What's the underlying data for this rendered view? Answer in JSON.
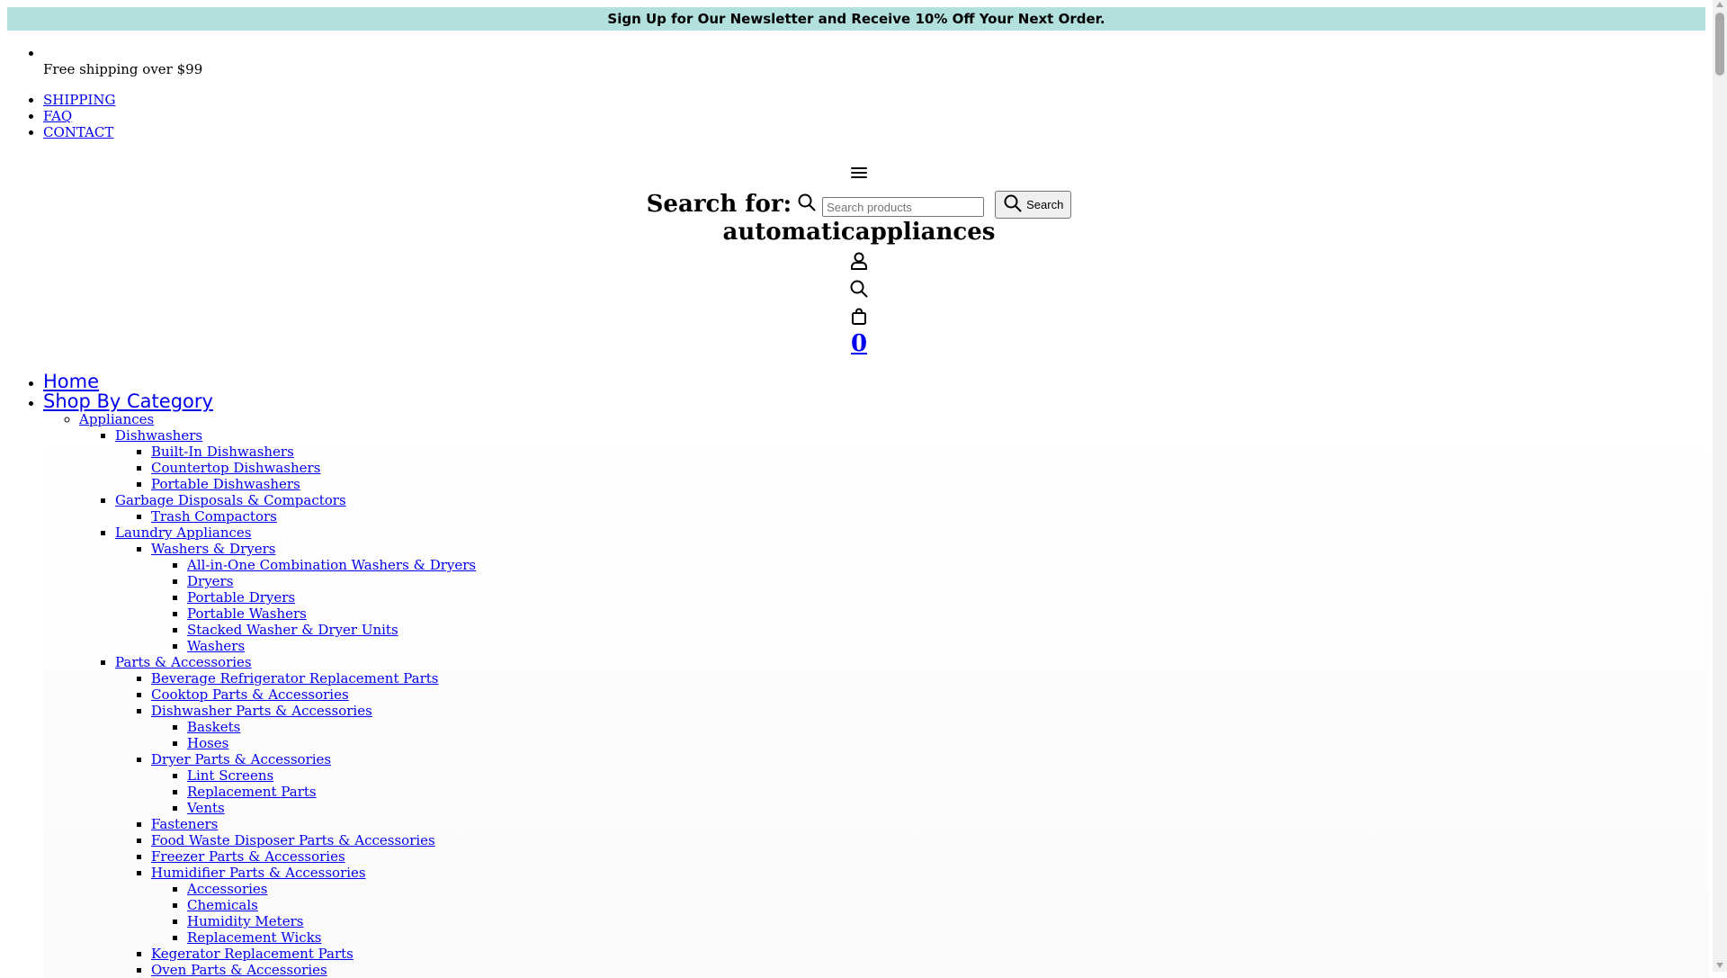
{
  "announcement": "Sign Up for Our Newsletter and Receive 10% Off Your Next Order.",
  "shipping_note": "Free shipping over $99",
  "utility_links": [
    "SHIPPING",
    "FAQ",
    "CONTACT"
  ],
  "search": {
    "label": "Search for:",
    "placeholder": "Search products",
    "button_label": "Search"
  },
  "brand": "automaticappliances",
  "cart": {
    "count": "0"
  },
  "nav": {
    "home": "Home",
    "shop_by_category": "Shop By Category",
    "appliances": "Appliances",
    "dishwashers": "Dishwashers",
    "dishwashers_items": [
      "Built-In Dishwashers",
      "Countertop Dishwashers",
      "Portable Dishwashers"
    ],
    "garbage": "Garbage Disposals & Compactors",
    "garbage_items": [
      "Trash Compactors"
    ],
    "laundry": "Laundry Appliances",
    "washers_dryers": "Washers & Dryers",
    "washers_dryers_items": [
      "All-in-One Combination Washers & Dryers",
      "Dryers",
      "Portable Dryers",
      "Portable Washers",
      "Stacked Washer & Dryer Units",
      "Washers"
    ],
    "parts": "Parts & Accessories",
    "parts_items_a": [
      "Beverage Refrigerator Replacement Parts",
      "Cooktop Parts & Accessories"
    ],
    "dishwasher_parts": "Dishwasher Parts & Accessories",
    "dishwasher_parts_items": [
      "Baskets",
      "Hoses"
    ],
    "dryer_parts": "Dryer Parts & Accessories",
    "dryer_parts_items": [
      "Lint Screens",
      "Replacement Parts",
      "Vents"
    ],
    "parts_items_b": [
      "Fasteners",
      "Food Waste Disposer Parts & Accessories",
      "Freezer Parts & Accessories"
    ],
    "humidifier_parts": "Humidifier Parts & Accessories",
    "humidifier_parts_items": [
      "Accessories",
      "Chemicals",
      "Humidity Meters",
      "Replacement Wicks"
    ],
    "parts_items_c": [
      "Kegerator Replacement Parts",
      "Oven Parts & Accessories"
    ]
  }
}
